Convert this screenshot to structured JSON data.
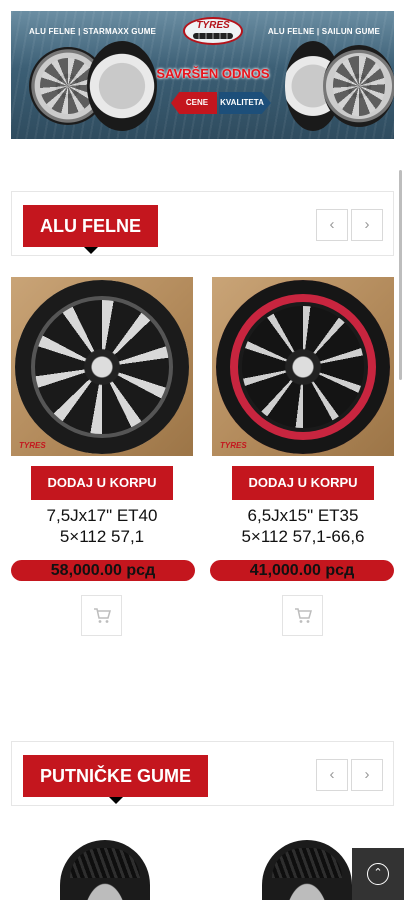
{
  "banner": {
    "caption_left": "ALU FELNE  |  STARMAXX GUME",
    "caption_right": "ALU FELNE  |  SAILUN GUME",
    "logo_text": "TYRES",
    "slogan": "SAVRŠEN ODNOS",
    "pill_left": "CENE",
    "pill_right": "KVALITETA"
  },
  "sections": [
    {
      "title": "ALU FELNE",
      "products": [
        {
          "brand_mark": "TYRES",
          "cart_label": "DODAJ U KORPU",
          "title_line1": "7,5Jx17\" ET40",
          "title_line2": "5×112 57,1",
          "price": "58,000.00 рсд"
        },
        {
          "brand_mark": "TYRES",
          "cart_label": "DODAJ U KORPU",
          "title_line1": "6,5Jx15\" ET35",
          "title_line2": "5×112 57,1-66,6",
          "price": "41,000.00 рсд"
        }
      ]
    },
    {
      "title": "PUTNIČKE GUME"
    }
  ],
  "icons": {
    "prev": "chevron-left-icon",
    "next": "chevron-right-icon",
    "cart": "shopping-cart-icon",
    "scroll_top": "chevron-up-icon"
  },
  "colors": {
    "accent": "#c4161e",
    "dark": "#333333"
  }
}
